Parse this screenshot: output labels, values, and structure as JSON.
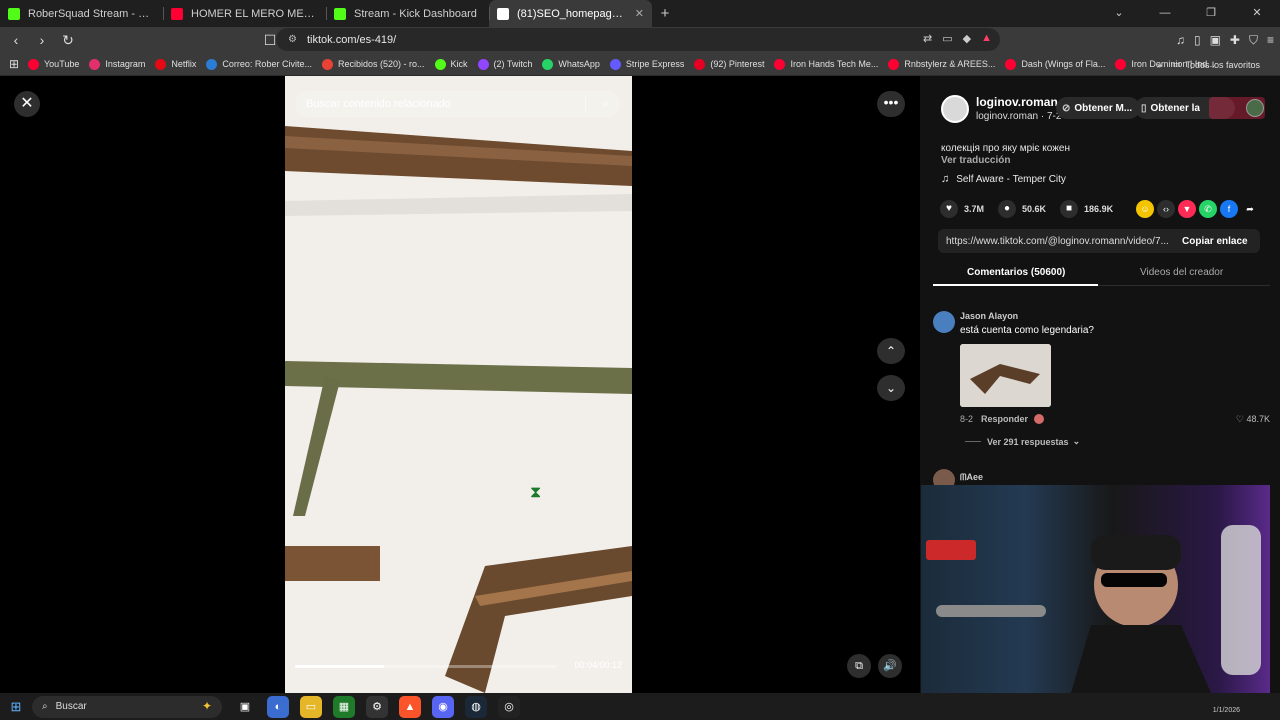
{
  "browser": {
    "tabs": [
      {
        "label": "RoberSquad Stream - Watch Live",
        "color": "#53fc18",
        "active": false
      },
      {
        "label": "HOMER EL MERO MERO X YSY A - D",
        "color": "#ff0033",
        "active": false
      },
      {
        "label": "Stream - Kick Dashboard",
        "color": "#53fc18",
        "active": false
      },
      {
        "label": "(81)SEO_homepage_title",
        "color": "#ffffff",
        "active": true
      }
    ],
    "url": "tiktok.com/es-419/",
    "bookmarks": [
      {
        "label": "YouTube",
        "color": "#ff0033"
      },
      {
        "label": "Instagram",
        "color": "#e1306c"
      },
      {
        "label": "Netflix",
        "color": "#e50914"
      },
      {
        "label": "Correo: Rober Civite...",
        "color": "#2b7cd3"
      },
      {
        "label": "Recibidos (520) - ro...",
        "color": "#ea4335"
      },
      {
        "label": "Kick",
        "color": "#53fc18"
      },
      {
        "label": "(2) Twitch",
        "color": "#9146ff"
      },
      {
        "label": "WhatsApp",
        "color": "#25d366"
      },
      {
        "label": "Stripe Express",
        "color": "#635bff"
      },
      {
        "label": "(92) Pinterest",
        "color": "#e60023"
      },
      {
        "label": "Iron Hands Tech Me...",
        "color": "#ff0033"
      },
      {
        "label": "Rnbstylerz & AREES...",
        "color": "#ff0033"
      },
      {
        "label": "Dash (Wings of Fla...",
        "color": "#ff0033"
      },
      {
        "label": "Iron Dominion | Ind...",
        "color": "#ff0033"
      }
    ],
    "all_favorites": "Todos los favoritos"
  },
  "video": {
    "search_placeholder": "Buscar contenido relacionado",
    "time": "00:04/00:12",
    "progress_fraction": 0.34
  },
  "author": {
    "name": "loginov.roman",
    "sub": "loginov.roman · 7-2",
    "obtain_1": "Obtener M...",
    "obtain_2": "Obtener la",
    "description": "колекція про яку мріє кожен",
    "translate": "Ver traducción",
    "music": "Self Aware - Temper City"
  },
  "stats": {
    "likes": "3.7M",
    "comments": "50.6K",
    "saves": "186.9K"
  },
  "share": {
    "link": "https://www.tiktok.com/@loginov.romann/video/7...",
    "copy": "Copiar enlace"
  },
  "tabs": {
    "comments": "Comentarios (50600)",
    "creator": "Videos del creador"
  },
  "comment": {
    "user": "Jason Alayon",
    "text": "está cuenta como legendaria?",
    "date": "8-2",
    "reply": "Responder",
    "likes": "48.7K",
    "replies": "Ver 291 respuestas"
  },
  "comment2": {
    "user": "ᗰAee"
  },
  "taskbar": {
    "search": "Buscar",
    "clock": "1/1/2026"
  }
}
